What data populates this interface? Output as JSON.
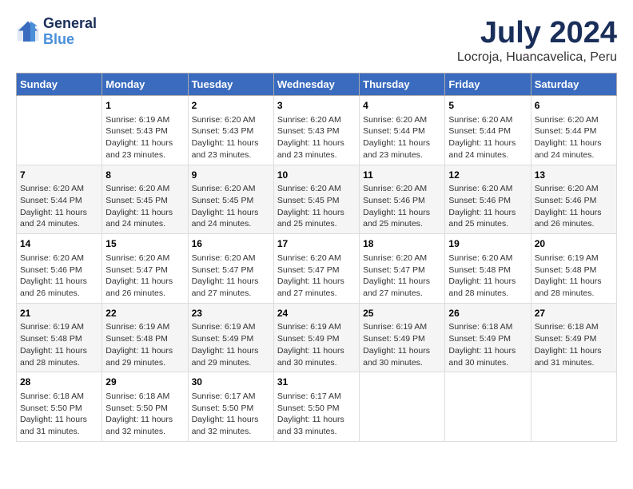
{
  "header": {
    "logo_line1": "General",
    "logo_line2": "Blue",
    "title": "July 2024",
    "subtitle": "Locroja, Huancavelica, Peru"
  },
  "calendar": {
    "days_of_week": [
      "Sunday",
      "Monday",
      "Tuesday",
      "Wednesday",
      "Thursday",
      "Friday",
      "Saturday"
    ],
    "weeks": [
      [
        {
          "day": "",
          "info": ""
        },
        {
          "day": "1",
          "info": "Sunrise: 6:19 AM\nSunset: 5:43 PM\nDaylight: 11 hours\nand 23 minutes."
        },
        {
          "day": "2",
          "info": "Sunrise: 6:20 AM\nSunset: 5:43 PM\nDaylight: 11 hours\nand 23 minutes."
        },
        {
          "day": "3",
          "info": "Sunrise: 6:20 AM\nSunset: 5:43 PM\nDaylight: 11 hours\nand 23 minutes."
        },
        {
          "day": "4",
          "info": "Sunrise: 6:20 AM\nSunset: 5:44 PM\nDaylight: 11 hours\nand 23 minutes."
        },
        {
          "day": "5",
          "info": "Sunrise: 6:20 AM\nSunset: 5:44 PM\nDaylight: 11 hours\nand 24 minutes."
        },
        {
          "day": "6",
          "info": "Sunrise: 6:20 AM\nSunset: 5:44 PM\nDaylight: 11 hours\nand 24 minutes."
        }
      ],
      [
        {
          "day": "7",
          "info": "Sunrise: 6:20 AM\nSunset: 5:44 PM\nDaylight: 11 hours\nand 24 minutes."
        },
        {
          "day": "8",
          "info": "Sunrise: 6:20 AM\nSunset: 5:45 PM\nDaylight: 11 hours\nand 24 minutes."
        },
        {
          "day": "9",
          "info": "Sunrise: 6:20 AM\nSunset: 5:45 PM\nDaylight: 11 hours\nand 24 minutes."
        },
        {
          "day": "10",
          "info": "Sunrise: 6:20 AM\nSunset: 5:45 PM\nDaylight: 11 hours\nand 25 minutes."
        },
        {
          "day": "11",
          "info": "Sunrise: 6:20 AM\nSunset: 5:46 PM\nDaylight: 11 hours\nand 25 minutes."
        },
        {
          "day": "12",
          "info": "Sunrise: 6:20 AM\nSunset: 5:46 PM\nDaylight: 11 hours\nand 25 minutes."
        },
        {
          "day": "13",
          "info": "Sunrise: 6:20 AM\nSunset: 5:46 PM\nDaylight: 11 hours\nand 26 minutes."
        }
      ],
      [
        {
          "day": "14",
          "info": "Sunrise: 6:20 AM\nSunset: 5:46 PM\nDaylight: 11 hours\nand 26 minutes."
        },
        {
          "day": "15",
          "info": "Sunrise: 6:20 AM\nSunset: 5:47 PM\nDaylight: 11 hours\nand 26 minutes."
        },
        {
          "day": "16",
          "info": "Sunrise: 6:20 AM\nSunset: 5:47 PM\nDaylight: 11 hours\nand 27 minutes."
        },
        {
          "day": "17",
          "info": "Sunrise: 6:20 AM\nSunset: 5:47 PM\nDaylight: 11 hours\nand 27 minutes."
        },
        {
          "day": "18",
          "info": "Sunrise: 6:20 AM\nSunset: 5:47 PM\nDaylight: 11 hours\nand 27 minutes."
        },
        {
          "day": "19",
          "info": "Sunrise: 6:20 AM\nSunset: 5:48 PM\nDaylight: 11 hours\nand 28 minutes."
        },
        {
          "day": "20",
          "info": "Sunrise: 6:19 AM\nSunset: 5:48 PM\nDaylight: 11 hours\nand 28 minutes."
        }
      ],
      [
        {
          "day": "21",
          "info": "Sunrise: 6:19 AM\nSunset: 5:48 PM\nDaylight: 11 hours\nand 28 minutes."
        },
        {
          "day": "22",
          "info": "Sunrise: 6:19 AM\nSunset: 5:48 PM\nDaylight: 11 hours\nand 29 minutes."
        },
        {
          "day": "23",
          "info": "Sunrise: 6:19 AM\nSunset: 5:49 PM\nDaylight: 11 hours\nand 29 minutes."
        },
        {
          "day": "24",
          "info": "Sunrise: 6:19 AM\nSunset: 5:49 PM\nDaylight: 11 hours\nand 30 minutes."
        },
        {
          "day": "25",
          "info": "Sunrise: 6:19 AM\nSunset: 5:49 PM\nDaylight: 11 hours\nand 30 minutes."
        },
        {
          "day": "26",
          "info": "Sunrise: 6:18 AM\nSunset: 5:49 PM\nDaylight: 11 hours\nand 30 minutes."
        },
        {
          "day": "27",
          "info": "Sunrise: 6:18 AM\nSunset: 5:49 PM\nDaylight: 11 hours\nand 31 minutes."
        }
      ],
      [
        {
          "day": "28",
          "info": "Sunrise: 6:18 AM\nSunset: 5:50 PM\nDaylight: 11 hours\nand 31 minutes."
        },
        {
          "day": "29",
          "info": "Sunrise: 6:18 AM\nSunset: 5:50 PM\nDaylight: 11 hours\nand 32 minutes."
        },
        {
          "day": "30",
          "info": "Sunrise: 6:17 AM\nSunset: 5:50 PM\nDaylight: 11 hours\nand 32 minutes."
        },
        {
          "day": "31",
          "info": "Sunrise: 6:17 AM\nSunset: 5:50 PM\nDaylight: 11 hours\nand 33 minutes."
        },
        {
          "day": "",
          "info": ""
        },
        {
          "day": "",
          "info": ""
        },
        {
          "day": "",
          "info": ""
        }
      ]
    ]
  }
}
